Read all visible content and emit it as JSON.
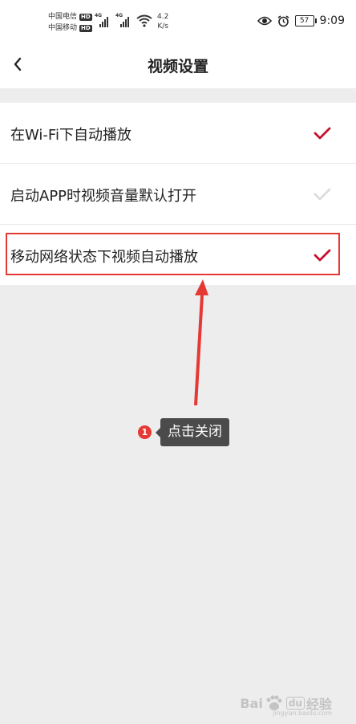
{
  "status_bar": {
    "carrier1": "中国电信",
    "carrier2": "中国移动",
    "hd_badge": "HD",
    "net_type": "4G",
    "speed_value": "4.2",
    "speed_unit": "K/s",
    "battery": "57",
    "time": "9:09",
    "icons": [
      "eye-icon",
      "alarm-icon",
      "wifi-icon",
      "signal-icon",
      "battery-icon"
    ]
  },
  "navbar": {
    "title": "视频设置",
    "back_icon": "chevron-left-icon"
  },
  "settings": {
    "items": [
      {
        "label": "在Wi-Fi下自动播放",
        "checked": true
      },
      {
        "label": "启动APP时视频音量默认打开",
        "checked": false
      },
      {
        "label": "移动网络状态下视频自动播放",
        "checked": true
      }
    ]
  },
  "annotation": {
    "step_number": "1",
    "tooltip": "点击关闭"
  },
  "watermark": {
    "brand_a": "Bai",
    "brand_b": "经验",
    "jy": "du",
    "url": "jingyan.baidu.com"
  },
  "colors": {
    "check_on": "#c8102e",
    "check_off": "#dcdcdc",
    "highlight": "#e53935",
    "page_bg": "#ededee"
  }
}
